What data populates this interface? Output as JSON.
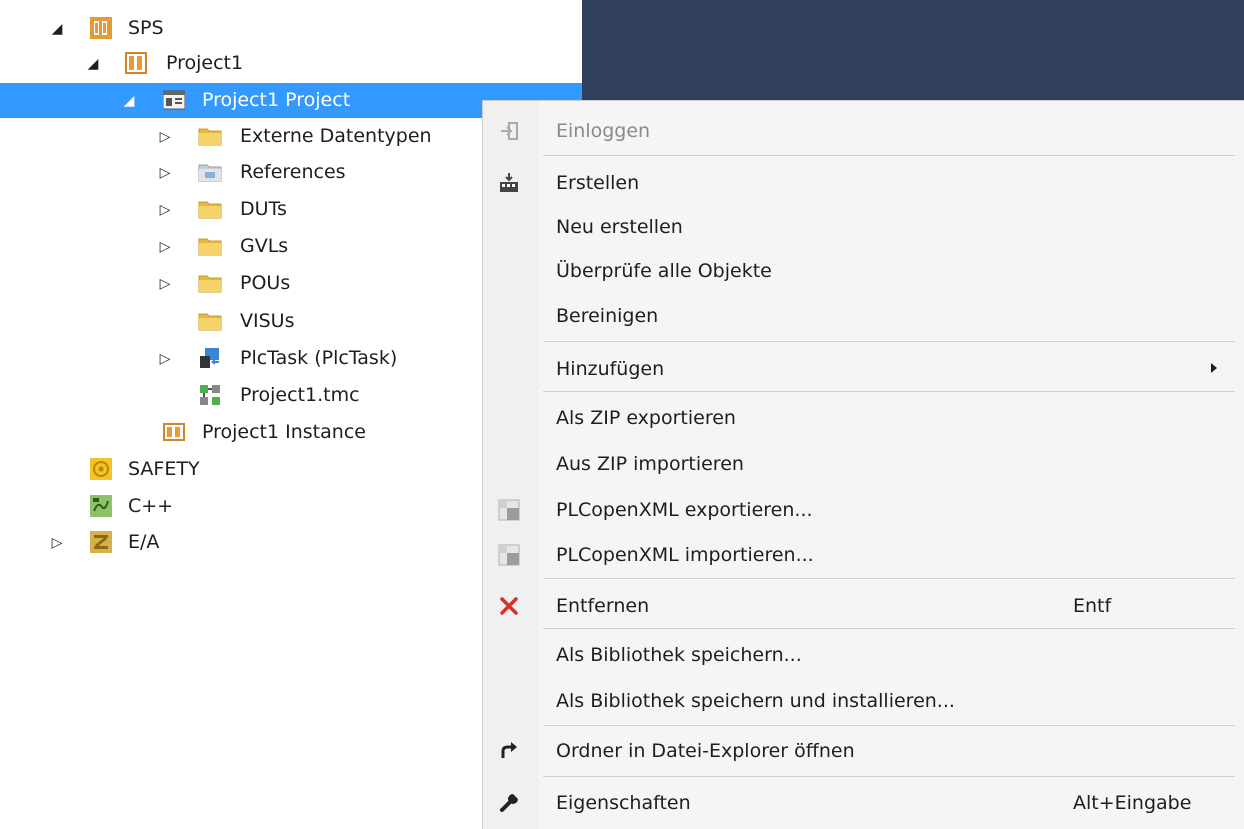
{
  "tree": {
    "items": [
      {
        "label": "SPS",
        "icon": "plc-icon",
        "arrow": "◢",
        "selected": false
      },
      {
        "label": "Project1",
        "icon": "plc-project-icon",
        "arrow": "◢",
        "selected": false
      },
      {
        "label": "Project1 Project",
        "icon": "project-file-icon",
        "arrow": "◢",
        "selected": true
      },
      {
        "label": "Externe Datentypen",
        "icon": "folder-icon",
        "arrow": "▷",
        "selected": false
      },
      {
        "label": "References",
        "icon": "references-icon",
        "arrow": "▷",
        "selected": false
      },
      {
        "label": "DUTs",
        "icon": "folder-icon",
        "arrow": "▷",
        "selected": false
      },
      {
        "label": "GVLs",
        "icon": "folder-icon",
        "arrow": "▷",
        "selected": false
      },
      {
        "label": "POUs",
        "icon": "folder-icon",
        "arrow": "▷",
        "selected": false
      },
      {
        "label": "VISUs",
        "icon": "folder-icon",
        "arrow": "",
        "selected": false
      },
      {
        "label": "PlcTask (PlcTask)",
        "icon": "task-icon",
        "arrow": "▷",
        "selected": false
      },
      {
        "label": "Project1.tmc",
        "icon": "tmc-icon",
        "arrow": "",
        "selected": false
      },
      {
        "label": "Project1 Instance",
        "icon": "instance-icon",
        "arrow": "",
        "selected": false
      },
      {
        "label": "SAFETY",
        "icon": "safety-icon",
        "arrow": "",
        "selected": false
      },
      {
        "label": "C++",
        "icon": "cpp-icon",
        "arrow": "",
        "selected": false
      },
      {
        "label": "E/A",
        "icon": "io-icon",
        "arrow": "▷",
        "selected": false
      }
    ]
  },
  "menu": {
    "items": [
      {
        "label": "Einloggen",
        "icon": "login-icon",
        "disabled": true
      },
      {
        "label": "Erstellen",
        "icon": "build-icon"
      },
      {
        "label": "Neu erstellen"
      },
      {
        "label": "Überprüfe alle Objekte"
      },
      {
        "label": "Bereinigen"
      },
      {
        "label": "Hinzufügen",
        "submenu": true
      },
      {
        "label": "Als ZIP exportieren"
      },
      {
        "label": "Aus ZIP importieren"
      },
      {
        "label": "PLCopenXML exportieren...",
        "icon": "plcopen-export-icon"
      },
      {
        "label": "PLCopenXML importieren...",
        "icon": "plcopen-import-icon"
      },
      {
        "label": "Entfernen",
        "icon": "delete-icon",
        "shortcut": "Entf"
      },
      {
        "label": "Als Bibliothek speichern..."
      },
      {
        "label": "Als Bibliothek speichern und installieren..."
      },
      {
        "label": "Ordner in Datei-Explorer öffnen",
        "icon": "open-folder-arrow-icon"
      },
      {
        "label": "Eigenschaften",
        "icon": "wrench-icon",
        "shortcut": "Alt+Eingabe"
      }
    ]
  },
  "colors": {
    "selection": "#3399ff",
    "dark_panel": "#2f3f5c",
    "menu_background": "#f5f5f5",
    "delete_icon": "#d9302c",
    "plc_icon": "#e59a34"
  }
}
